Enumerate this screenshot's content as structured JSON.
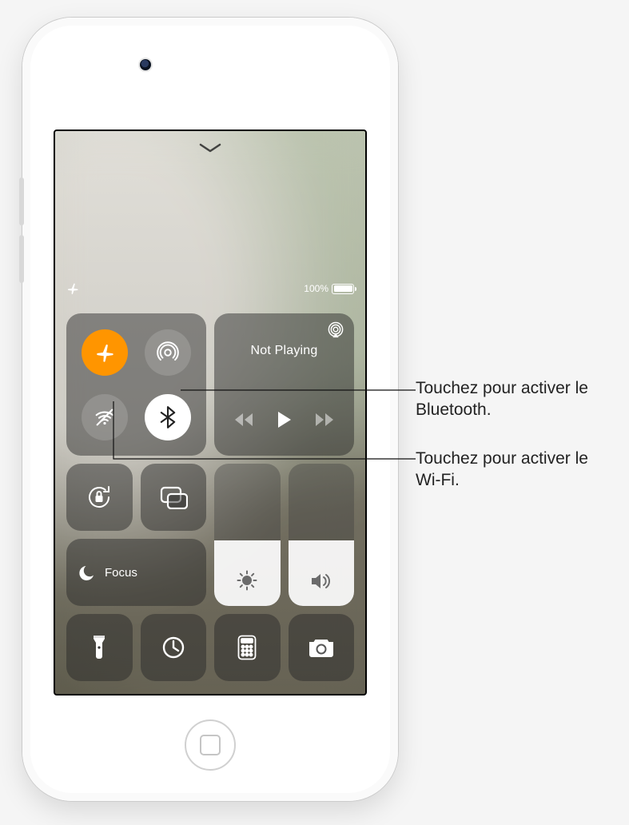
{
  "status": {
    "battery_label": "100%"
  },
  "media": {
    "state_label": "Not Playing"
  },
  "focus": {
    "label": "Focus"
  },
  "callouts": {
    "bluetooth": "Touchez pour activer le Bluetooth.",
    "wifi": "Touchez pour activer le Wi-Fi."
  },
  "icons": {
    "airplane": "airplane-icon",
    "airdrop": "airdrop-icon",
    "wifi_off": "wifi-off-icon",
    "bluetooth": "bluetooth-icon",
    "airplay": "airplay-audio-icon",
    "prev": "skip-back-icon",
    "play": "play-icon",
    "next": "skip-forward-icon",
    "orientation_lock": "orientation-lock-icon",
    "screen_mirror": "screen-mirroring-icon",
    "dnd": "moon-icon",
    "brightness": "brightness-icon",
    "volume": "volume-icon",
    "flashlight": "flashlight-icon",
    "timer": "timer-icon",
    "calculator": "calculator-icon",
    "camera": "camera-icon",
    "chevron": "chevron-down-icon"
  }
}
